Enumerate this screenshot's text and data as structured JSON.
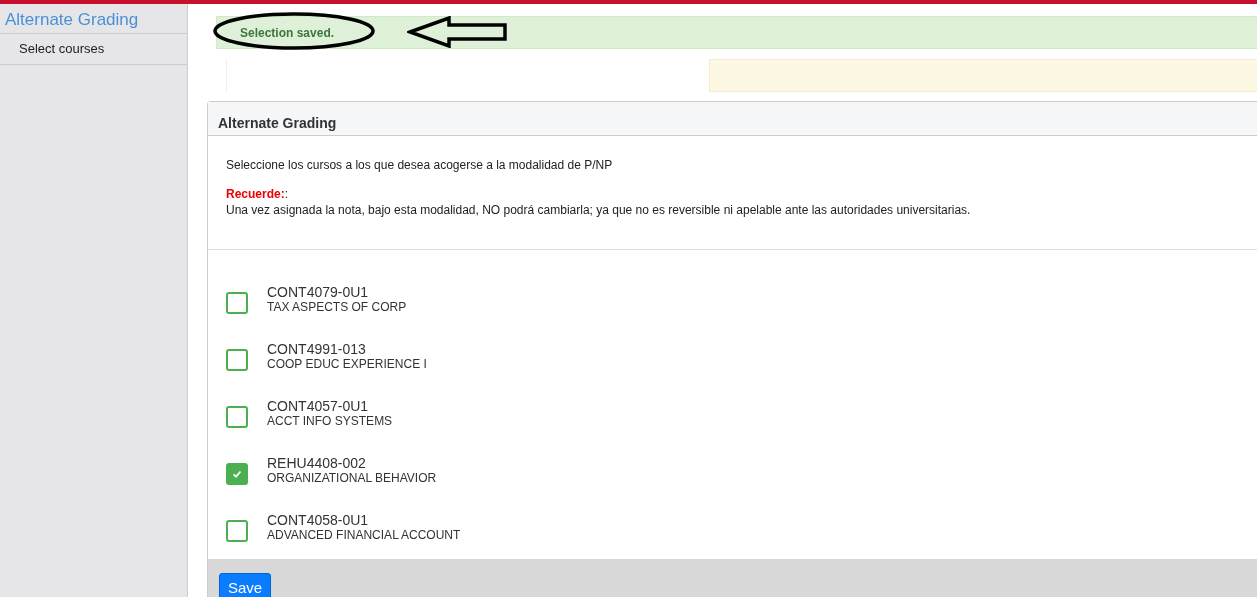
{
  "sidebar": {
    "title": "Alternate Grading",
    "items": [
      {
        "label": "Select courses",
        "selected": false
      }
    ]
  },
  "alert": {
    "message": "Selection saved."
  },
  "panel": {
    "title": "Alternate Grading",
    "instruction": "Seleccione los cursos a los que desea acogerse a la modalidad de P/NP",
    "note_label": "Recuerde:",
    "note_suffix": ":",
    "note": "Una vez asignada la nota, bajo esta modalidad, NO podrá cambiarla; ya que no es reversible ni apelable ante las autoridades universitarias.",
    "courses": [
      {
        "code": "CONT4079-0U1",
        "name": "TAX ASPECTS OF CORP",
        "checked": false
      },
      {
        "code": "CONT4991-013",
        "name": "COOP EDUC EXPERIENCE I",
        "checked": false
      },
      {
        "code": "CONT4057-0U1",
        "name": "ACCT INFO SYSTEMS",
        "checked": false
      },
      {
        "code": "REHU4408-002",
        "name": "ORGANIZATIONAL BEHAVIOR",
        "checked": true
      },
      {
        "code": "CONT4058-0U1",
        "name": "ADVANCED FINANCIAL ACCOUNT",
        "checked": false
      }
    ],
    "save_button": "Save"
  }
}
